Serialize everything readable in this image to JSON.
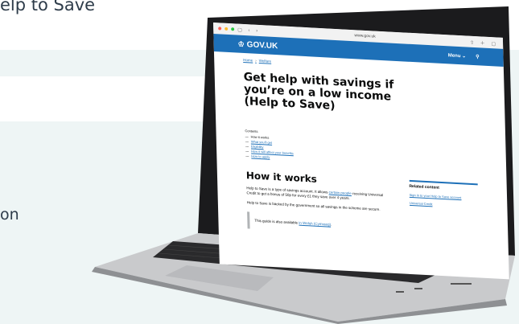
{
  "slide": {
    "title_fragment": "elp to Save",
    "text_fragment": "on"
  },
  "browser": {
    "url": "www.gov.uk",
    "traffic_colors": [
      "#ff5f57",
      "#febc2e",
      "#28c840"
    ]
  },
  "header": {
    "logo": "GOV.UK",
    "menu_label": "Menu",
    "brand_color": "#1d70b8"
  },
  "breadcrumb": [
    "Home",
    "Welfare"
  ],
  "page": {
    "title": "Get help with savings if you’re on a low income (Help to Save)",
    "contents_label": "Contents",
    "contents": [
      {
        "label": "How it works",
        "current": true
      },
      {
        "label": "What you’ll get",
        "current": false
      },
      {
        "label": "Eligibility",
        "current": false
      },
      {
        "label": "How it will affect your benefits",
        "current": false
      },
      {
        "label": "How to apply",
        "current": false
      }
    ],
    "section_heading": "How it works",
    "para1_start": "Help to Save is a type of savings account. It allows ",
    "para1_link": "certain people",
    "para1_end": " receiving Universal Credit to get a bonus of 50p for every £1 they save over 4 years.",
    "para2": "Help to Save is backed by the government so all savings in the scheme are secure.",
    "inset_start": "This guide is also available ",
    "inset_link": "in Welsh (Cymraeg)",
    "inset_end": "."
  },
  "related": {
    "title": "Related content",
    "links": [
      "Sign in to your Help to Save account",
      "Universal Credit"
    ]
  }
}
